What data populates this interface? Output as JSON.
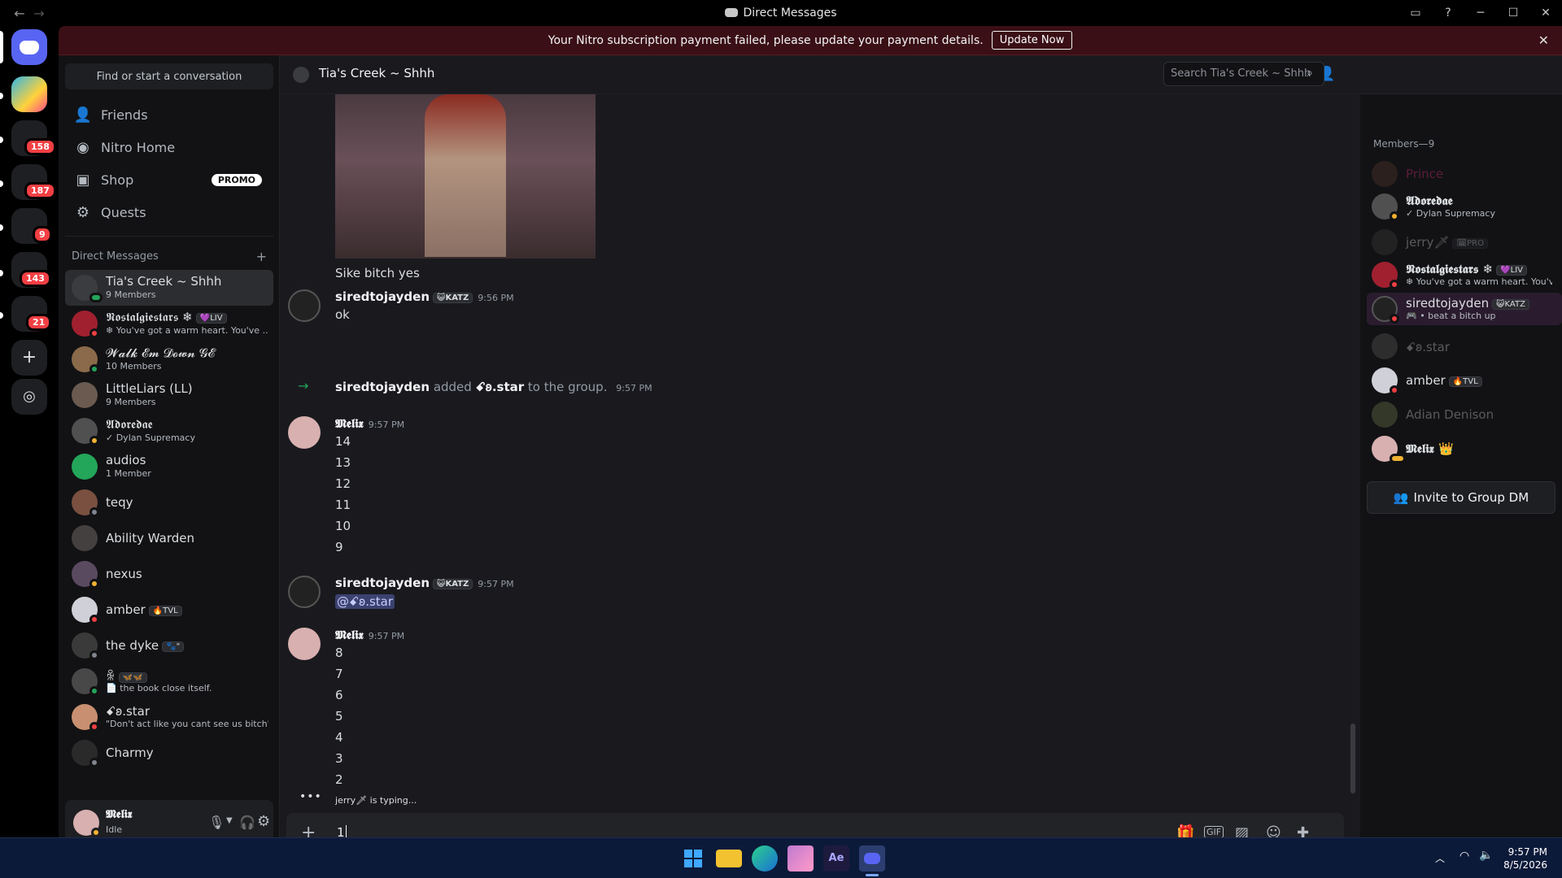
{
  "window": {
    "title": "Direct Messages"
  },
  "rail": {
    "badges": [
      "158",
      "187",
      "9",
      "143",
      "21"
    ]
  },
  "banner": {
    "text": "Your Nitro subscription payment failed, please update your payment details.",
    "button": "Update Now"
  },
  "sidebar": {
    "find": "Find or start a conversation",
    "nav": [
      {
        "label": "Friends",
        "icon": "friends-icon"
      },
      {
        "label": "Nitro Home",
        "icon": "nitro-icon"
      },
      {
        "label": "Shop",
        "icon": "shop-icon",
        "badge": "PROMO"
      },
      {
        "label": "Quests",
        "icon": "quests-icon"
      }
    ],
    "dm_header": "Direct Messages",
    "dms": [
      {
        "name": "Tia's Creek ~ Shhh",
        "sub": "9 Members"
      },
      {
        "name": "𝕹𝖔𝖘𝖙𝖆𝖑𝖌𝖎𝖊𝖘𝖙𝖆𝖗𝖘 ❄",
        "tag": "💜LIV",
        "sub": "❄ You've got a warm heart. You've ..."
      },
      {
        "name": "𝓦𝓪𝓵𝓴 𝓔𝓶 𝓓𝓸𝔀𝓷 𝓖𝓔",
        "sub": "10 Members"
      },
      {
        "name": "LittleLiars (LL)",
        "sub": "9 Members"
      },
      {
        "name": "𝕬𝖉𝖔𝖗𝖊𝖉𝖆𝖊",
        "sub": "✓ Dylan Supremacy"
      },
      {
        "name": "audios",
        "sub": "1 Member"
      },
      {
        "name": "teqy"
      },
      {
        "name": "Ability Warden"
      },
      {
        "name": "nexus"
      },
      {
        "name": "amber",
        "tag": "🔥TVL"
      },
      {
        "name": "the dyke",
        "tag": "🐾\""
      },
      {
        "name": "ꆜ",
        "tag": "🦋🦋",
        "sub": "📄 the book close itself."
      },
      {
        "name": "ꗃ𐐪.star",
        "sub": "\"Don't act like you cant see us bitch\""
      },
      {
        "name": "Charmy"
      }
    ]
  },
  "user": {
    "name": "𝕸𝖊𝖑𝖎𝖝",
    "status": "Idle"
  },
  "channel": {
    "name": "Tia's Creek ~ Shhh",
    "search_placeholder": "Search Tia's Creek ~ Shhh"
  },
  "messages": {
    "caption": "Sike bitch yes",
    "m1": {
      "author": "siredtojayden",
      "tag": "😺KATZ",
      "time": "9:56 PM",
      "text": "ok"
    },
    "system": {
      "actor": "siredtojayden",
      "verb": "added",
      "target": "ꗃ𐐪.star",
      "rest": "to the group.",
      "time": "9:57 PM"
    },
    "m2": {
      "author": "𝕸𝖊𝖑𝖎𝖝",
      "time": "9:57 PM",
      "lines": [
        "14",
        "13",
        "12",
        "11",
        "10",
        "9"
      ]
    },
    "m3": {
      "author": "siredtojayden",
      "tag": "😺KATZ",
      "time": "9:57 PM",
      "mention": "@ꗃ𐐪.star"
    },
    "m4": {
      "author": "𝕸𝖊𝖑𝖎𝖝",
      "time": "9:57 PM",
      "lines": [
        "8",
        "7",
        "6",
        "5",
        "4",
        "3",
        "2"
      ]
    },
    "typing": "jerry🗡 is typing...",
    "composer_value": "1"
  },
  "members": {
    "header": "Members—9",
    "list": [
      {
        "name": "Prince"
      },
      {
        "name": "𝕬𝖉𝖔𝖗𝖊𝖉𝖆𝖊",
        "sub": "✓ Dylan Supremacy"
      },
      {
        "name": "jerry🗡",
        "tag": "🗓PRO"
      },
      {
        "name": "𝕹𝖔𝖘𝖙𝖆𝖑𝖌𝖎𝖊𝖘𝖙𝖆𝖗𝖘 ❄",
        "tag": "💜LIV",
        "sub": "❄ You've got a warm heart. You'v..."
      },
      {
        "name": "siredtojayden",
        "tag": "😺KATZ",
        "sub": "🎮 • beat a bitch up"
      },
      {
        "name": "ꗃ𐐪.star"
      },
      {
        "name": "amber",
        "tag": "🔥TVL"
      },
      {
        "name": "Adian Denison"
      },
      {
        "name": "𝕸𝖊𝖑𝖎𝖝 👑"
      }
    ],
    "invite": "Invite to Group DM"
  },
  "clock": {
    "time": "9:57 PM",
    "date": "8/5/2026"
  }
}
